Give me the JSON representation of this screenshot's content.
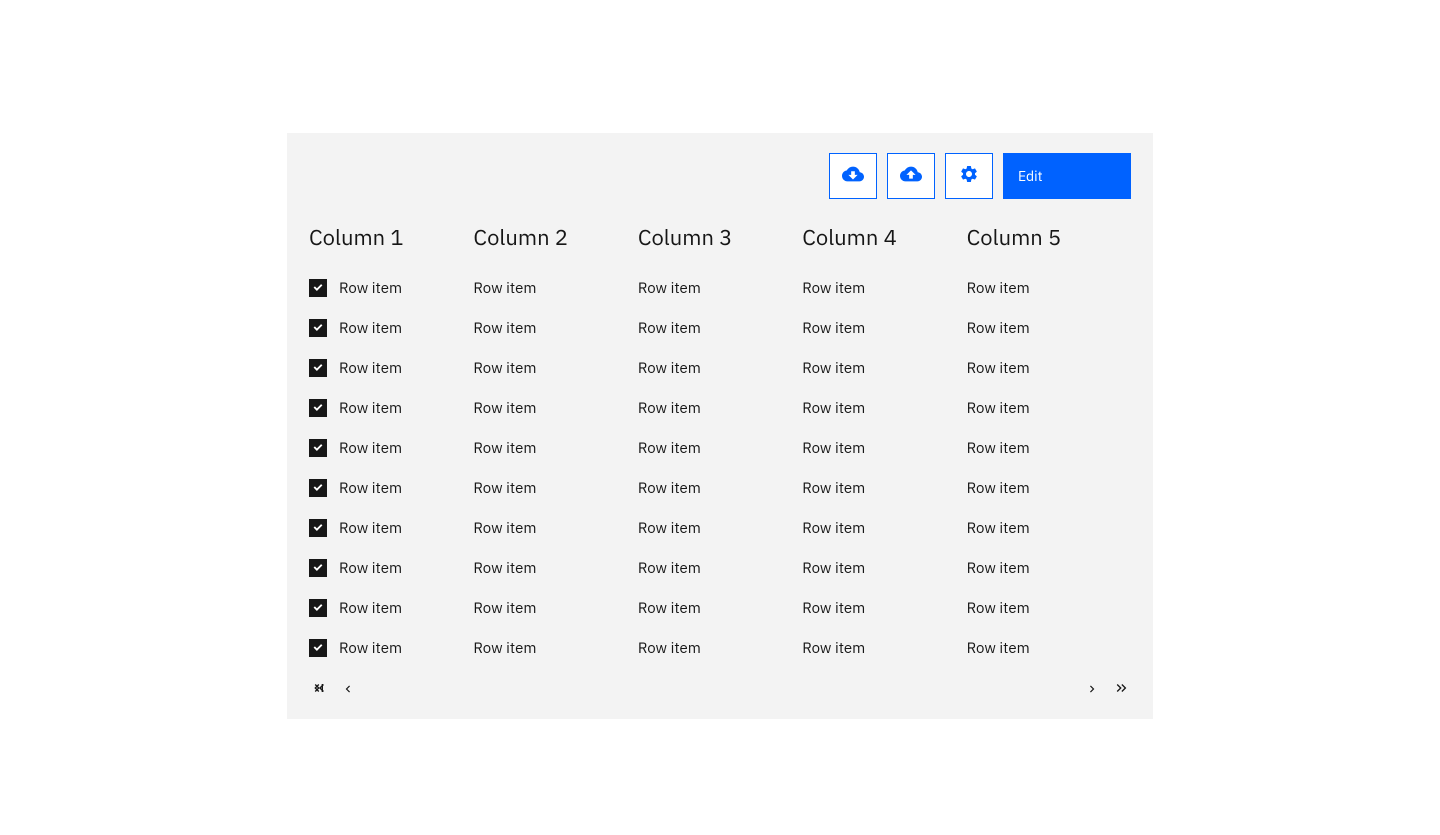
{
  "toolbar": {
    "edit_label": "Edit"
  },
  "columns": [
    {
      "header": "Column 1",
      "has_checkbox": true,
      "cells": [
        "Row item",
        "Row item",
        "Row item",
        "Row item",
        "Row item",
        "Row item",
        "Row item",
        "Row item",
        "Row item",
        "Row item"
      ]
    },
    {
      "header": "Column 2",
      "has_checkbox": false,
      "cells": [
        "Row item",
        "Row item",
        "Row item",
        "Row item",
        "Row item",
        "Row item",
        "Row item",
        "Row item",
        "Row item",
        "Row item"
      ]
    },
    {
      "header": "Column 3",
      "has_checkbox": false,
      "cells": [
        "Row item",
        "Row item",
        "Row item",
        "Row item",
        "Row item",
        "Row item",
        "Row item",
        "Row item",
        "Row item",
        "Row item"
      ]
    },
    {
      "header": "Column 4",
      "has_checkbox": false,
      "cells": [
        "Row item",
        "Row item",
        "Row item",
        "Row item",
        "Row item",
        "Row item",
        "Row item",
        "Row item",
        "Row item",
        "Row item"
      ]
    },
    {
      "header": "Column 5",
      "has_checkbox": false,
      "cells": [
        "Row item",
        "Row item",
        "Row item",
        "Row item",
        "Row item",
        "Row item",
        "Row item",
        "Row item",
        "Row item",
        "Row item"
      ]
    }
  ]
}
